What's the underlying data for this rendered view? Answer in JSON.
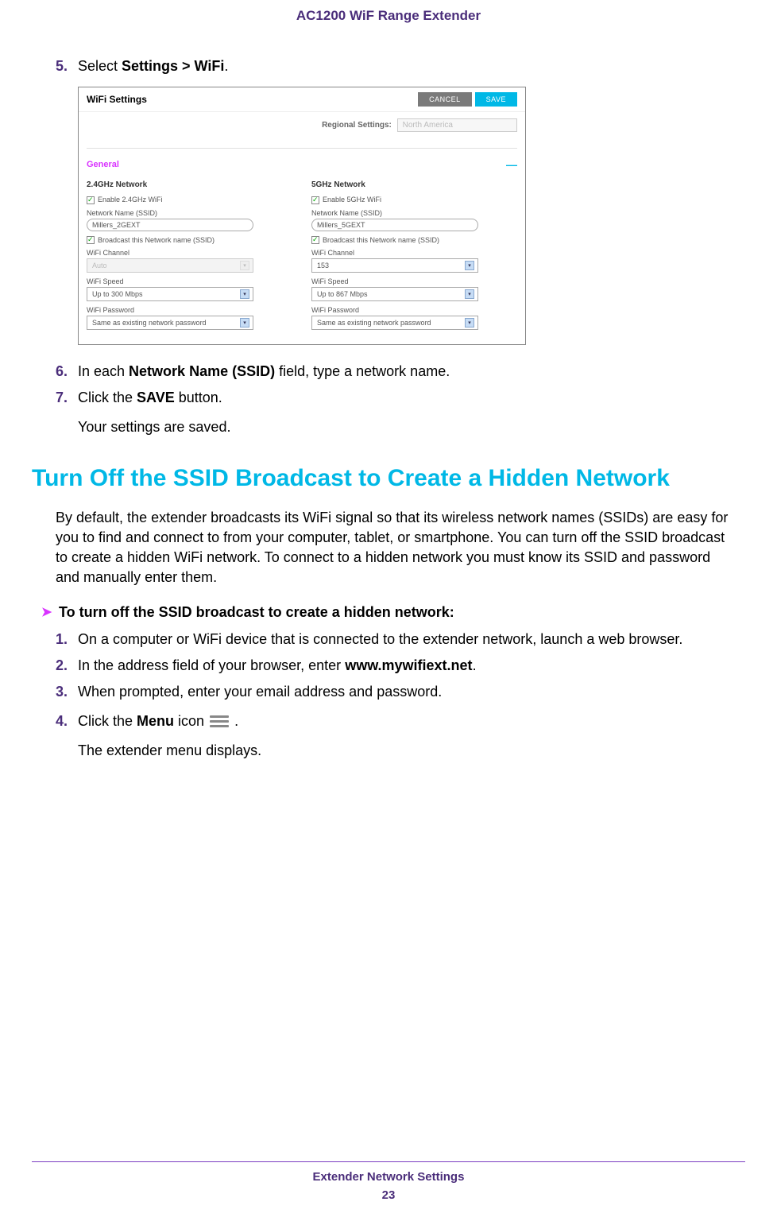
{
  "header": "AC1200 WiF Range Extender",
  "step5": {
    "num": "5.",
    "prefix": "Select ",
    "bold": "Settings > WiFi",
    "suffix": "."
  },
  "ui": {
    "title": "WiFi Settings",
    "cancel": "CANCEL",
    "save": "SAVE",
    "regional_label": "Regional Settings:",
    "regional_value": "North America",
    "general": "General",
    "col24": {
      "header": "2.4GHz Network",
      "enable": "Enable 2.4GHz WiFi",
      "ssid_label": "Network Name (SSID)",
      "ssid_value": "Millers_2GEXT",
      "broadcast": "Broadcast this Network name (SSID)",
      "channel_label": "WiFi Channel",
      "channel_value": "Auto",
      "speed_label": "WiFi Speed",
      "speed_value": "Up to 300 Mbps",
      "pwd_label": "WiFi Password",
      "pwd_value": "Same as existing network password"
    },
    "col5": {
      "header": "5GHz Network",
      "enable": "Enable 5GHz WiFi",
      "ssid_label": "Network Name (SSID)",
      "ssid_value": "Millers_5GEXT",
      "broadcast": "Broadcast this Network name (SSID)",
      "channel_label": "WiFi Channel",
      "channel_value": "153",
      "speed_label": "WiFi Speed",
      "speed_value": "Up to 867 Mbps",
      "pwd_label": "WiFi Password",
      "pwd_value": "Same as existing network password"
    }
  },
  "step6": {
    "num": "6.",
    "t1": "In each ",
    "b1": "Network Name (SSID)",
    "t2": " field, type a network name."
  },
  "step7": {
    "num": "7.",
    "t1": "Click the ",
    "b1": "SAVE",
    "t2": " button."
  },
  "step7_note": "Your settings are saved.",
  "h2": "Turn Off the SSID Broadcast to Create a Hidden Network",
  "para": "By default, the extender broadcasts its WiFi signal so that its wireless network names (SSIDs) are easy for you to find and connect to from your computer, tablet, or smartphone. You can turn off the SSID broadcast to create a hidden WiFi network. To connect to a hidden network you must know its SSID and password and manually enter them.",
  "proc_head": "To turn off the SSID broadcast to create a hidden network:",
  "b_step1": {
    "num": "1.",
    "text": "On a computer or WiFi device that is connected to the extender network, launch a web browser."
  },
  "b_step2": {
    "num": "2.",
    "t1": "In the address field of your browser, enter ",
    "b1": "www.mywifiext.net",
    "t2": "."
  },
  "b_step3": {
    "num": "3.",
    "text": "When prompted, enter your email address and password."
  },
  "b_step4": {
    "num": "4.",
    "t1": "Click the ",
    "b1": "Menu",
    "t2": " icon ",
    "t3": " ."
  },
  "b_step4_note": "The extender menu displays.",
  "footer_title": "Extender Network Settings",
  "footer_num": "23"
}
